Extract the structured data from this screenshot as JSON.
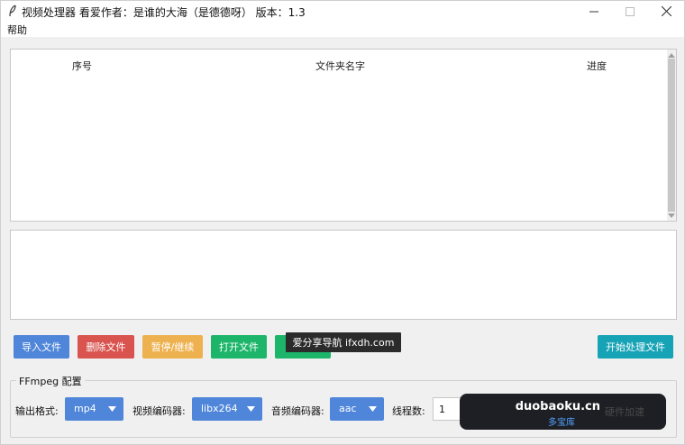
{
  "window": {
    "title": "视频处理器  看爱作者：是谁的大海（是德德呀）  版本：1.3"
  },
  "menu": {
    "help": "帮助"
  },
  "file_table": {
    "columns": [
      "序号",
      "文件夹名字",
      "进度"
    ],
    "rows": []
  },
  "toolbar": {
    "import_label": "导入文件",
    "delete_label": "删除文件",
    "pause_label": "暂停/继续",
    "open_label": "打开文件",
    "start_label": "开始处理文件"
  },
  "watermark_nav": {
    "text": "爱分享导航 ifxdh.com"
  },
  "ffmpeg_config": {
    "legend": "FFmpeg 配置",
    "output_format_label": "输出格式:",
    "output_format_value": "mp4",
    "video_codec_label": "视频编码器:",
    "video_codec_value": "libx264",
    "audio_codec_label": "音频编码器:",
    "audio_codec_value": "aac",
    "threads_label": "线程数:",
    "threads_value": "1"
  },
  "watermark_site": {
    "domain": "duobaoku.cn",
    "name": "多宝库",
    "tail": "硬件加速"
  },
  "colors": {
    "import": "#4f86d9",
    "delete": "#d9534f",
    "pause": "#eeb14f",
    "open": "#1cb56a",
    "start": "#16a3b6",
    "select": "#4f86d9"
  }
}
